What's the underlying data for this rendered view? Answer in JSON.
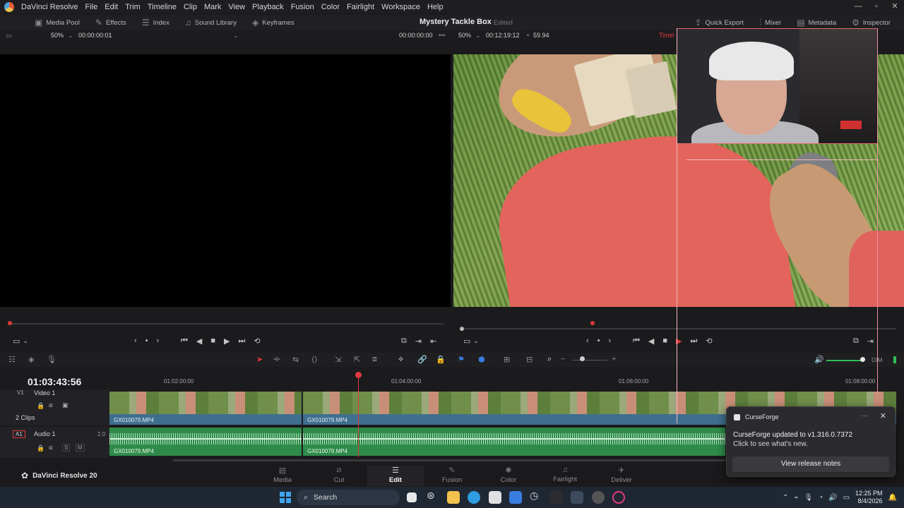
{
  "menu": {
    "app_name": "DaVinci Resolve",
    "items": [
      "File",
      "Edit",
      "Trim",
      "Timeline",
      "Clip",
      "Mark",
      "View",
      "Playback",
      "Fusion",
      "Color",
      "Fairlight",
      "Workspace",
      "Help"
    ]
  },
  "toolbar": {
    "left": [
      {
        "label": "Media Pool",
        "icon": "media-pool-icon"
      },
      {
        "label": "Effects",
        "icon": "effects-icon"
      },
      {
        "label": "Index",
        "icon": "index-icon"
      },
      {
        "label": "Sound Library",
        "icon": "sound-library-icon"
      },
      {
        "label": "Keyframes",
        "icon": "keyframes-icon"
      }
    ],
    "project_title": "Mystery Tackle Box",
    "project_status": "Edited",
    "right": [
      {
        "label": "Quick Export",
        "icon": "export-icon"
      },
      {
        "label": "Mixer",
        "icon": "mixer-icon"
      },
      {
        "label": "Metadata",
        "icon": "metadata-icon"
      },
      {
        "label": "Inspector",
        "icon": "inspector-icon"
      }
    ]
  },
  "source_viewer": {
    "zoom": "50%",
    "timecode": "00:00:00:01"
  },
  "record_viewer": {
    "source_timecode": "00:00:00:00",
    "zoom": "50%",
    "timecode": "00:12:19:12",
    "fps": "59.94",
    "timeline_label": "Timel"
  },
  "timeline": {
    "current_timecode": "01:03:43:56",
    "ruler_ticks": [
      "01:02:00:00",
      "01:04:00:00",
      "01:06:00:00",
      "01:08:00:00"
    ],
    "video_track": {
      "id": "V1",
      "name": "Video 1",
      "clip_count": "2 Clips"
    },
    "audio_track": {
      "id": "A1",
      "name": "Audio 1",
      "channels": "2.0",
      "solo": "S",
      "mute": "M"
    },
    "clips": [
      {
        "name": "GX010079.MP4"
      },
      {
        "name": "GX010079.MP4"
      }
    ],
    "audio_clips": [
      {
        "name": "GX010079.MP4"
      },
      {
        "name": "GX010079.MP4"
      }
    ],
    "dim_label": "DIM"
  },
  "pages": [
    {
      "label": "Media",
      "icon": "media-page-icon"
    },
    {
      "label": "Cut",
      "icon": "cut-page-icon"
    },
    {
      "label": "Edit",
      "icon": "edit-page-icon"
    },
    {
      "label": "Fusion",
      "icon": "fusion-page-icon"
    },
    {
      "label": "Color",
      "icon": "color-page-icon"
    },
    {
      "label": "Fairlight",
      "icon": "fairlight-page-icon"
    },
    {
      "label": "Deliver",
      "icon": "deliver-page-icon"
    }
  ],
  "active_page": "Edit",
  "brand": "DaVinci Resolve 20",
  "notification": {
    "app": "CurseForge",
    "title": "CurseForge updated to v1.316.0.7372",
    "subtitle": "Click to see what's new.",
    "button": "View release notes"
  },
  "taskbar": {
    "search_placeholder": "Search",
    "time": "12:25 PM",
    "date": "8/4/2026"
  },
  "colors": {
    "accent_red": "#e0393b",
    "video_clip": "#3f6f8f",
    "audio_clip": "#2f8b4a"
  }
}
